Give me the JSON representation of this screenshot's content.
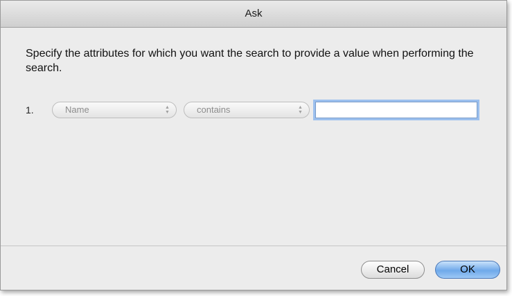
{
  "dialog": {
    "title": "Ask",
    "prompt": "Specify the attributes for which you want the search to provide a value when performing the search."
  },
  "criteria": [
    {
      "number": "1.",
      "attribute": "Name",
      "operator": "contains",
      "value": ""
    }
  ],
  "buttons": {
    "cancel": "Cancel",
    "ok": "OK"
  },
  "icons": {
    "popup_arrows": "updown-arrows-icon"
  },
  "colors": {
    "default_button": "#6fa9ea",
    "focus_ring": "#9cc0ee"
  }
}
